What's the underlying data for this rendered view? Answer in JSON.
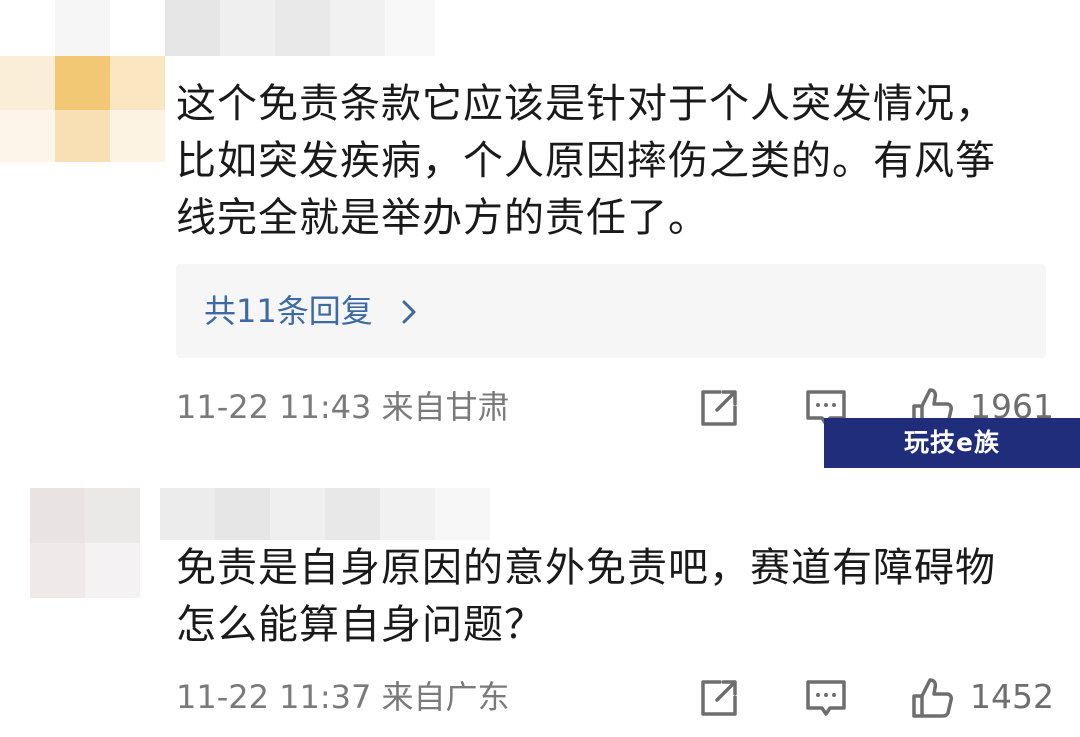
{
  "comments": [
    {
      "lines": [
        "这个免责条款它应该是针对于个人突发情况，",
        "比如突发疾病，个人原因摔伤之类的。有风筝",
        "线完全就是举办方的责任了。"
      ],
      "replies_label": "共11条回复",
      "timestamp": "11-22 11:43",
      "location": "来自甘肃",
      "likes": "1961"
    },
    {
      "lines": [
        "免责是自身原因的意外免责吧，赛道有障碍物",
        "怎么能算自身问题？"
      ],
      "timestamp": "11-22 11:37",
      "location": "来自广东",
      "likes": "1452"
    }
  ],
  "watermark": "玩技e族",
  "icons": [
    "share-icon",
    "comment-icon",
    "like-icon",
    "chevron-right-icon"
  ],
  "colors": {
    "reply_link": "#3e6aa3",
    "meta_text": "#7a7a7a",
    "watermark_bg": "#1f2d7a"
  }
}
